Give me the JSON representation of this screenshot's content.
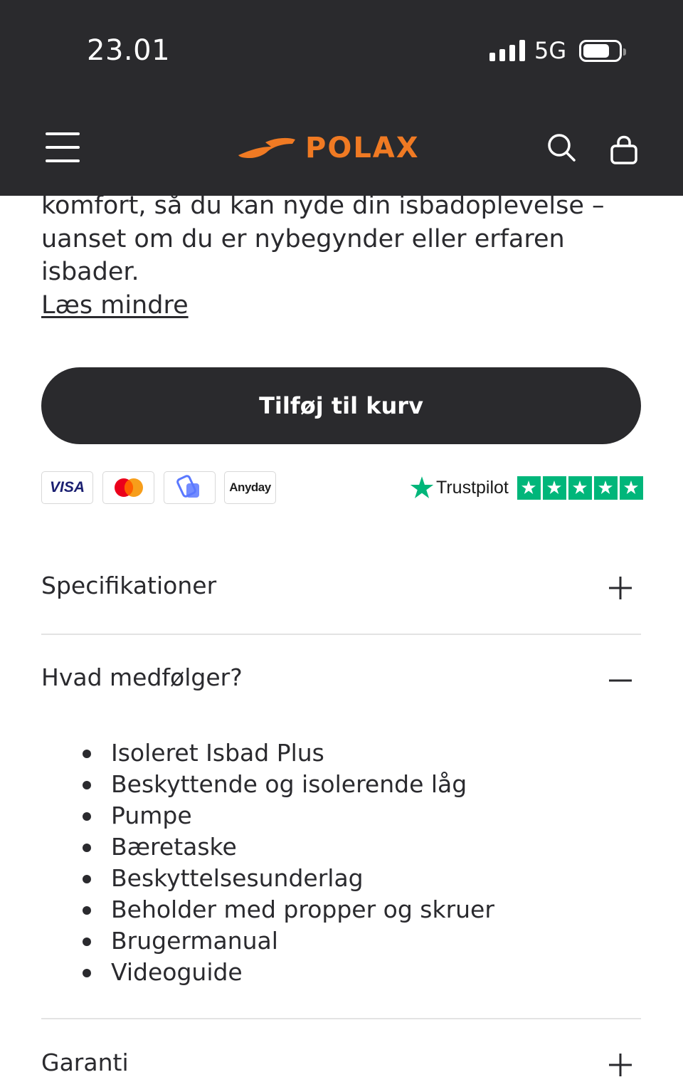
{
  "status_bar": {
    "time": "23.01",
    "network": "5G"
  },
  "header": {
    "brand": "POLAX",
    "brand_color": "#f07a23"
  },
  "description": {
    "text": "komfort, så du kan nyde din isbadoplevelse – uanset om du er nybegynder eller erfaren isbader.",
    "read_less": "Læs mindre"
  },
  "cart": {
    "add_label": "Tilføj til kurv"
  },
  "payment": {
    "visa": "VISA",
    "anyday": "Anyday",
    "icons": [
      "visa",
      "mastercard",
      "mobilepay",
      "anyday"
    ]
  },
  "trustpilot": {
    "label": "Trustpilot",
    "stars": 5,
    "color": "#00b67a"
  },
  "accordion": {
    "specs_title": "Specifikationer",
    "included_title": "Hvad medfølger?",
    "included_items": [
      "Isoleret Isbad Plus",
      "Beskyttende og isolerende låg",
      "Pumpe",
      "Bæretaske",
      "Beskyttelsesunderlag",
      "Beholder med propper og skruer",
      "Brugermanual",
      "Videoguide"
    ],
    "warranty_title": "Garanti"
  }
}
